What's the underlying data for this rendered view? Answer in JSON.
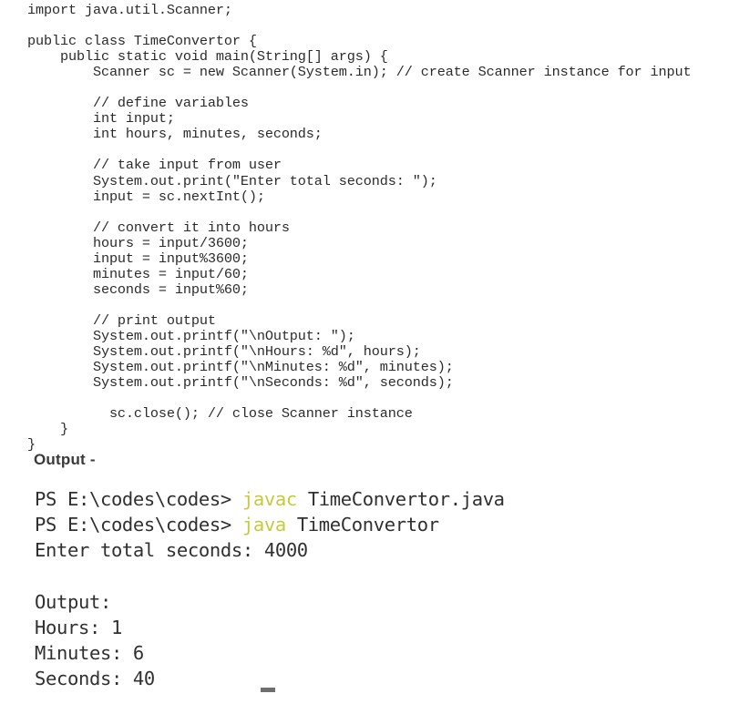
{
  "code": {
    "language": "java",
    "class_name": "TimeConvertor",
    "lines": [
      "import java.util.Scanner;",
      "",
      "public class TimeConvertor {",
      "    public static void main(String[] args) {",
      "        Scanner sc = new Scanner(System.in); // create Scanner instance for input",
      "",
      "        // define variables",
      "        int input;",
      "        int hours, minutes, seconds;",
      "",
      "        // take input from user",
      "        System.out.print(\"Enter total seconds: \");",
      "        input = sc.nextInt();",
      "",
      "        // convert it into hours",
      "        hours = input/3600;",
      "        input = input%3600;",
      "        minutes = input/60;",
      "        seconds = input%60;",
      "",
      "        // print output",
      "        System.out.printf(\"\\nOutput: \");",
      "        System.out.printf(\"\\nHours: %d\", hours);",
      "        System.out.printf(\"\\nMinutes: %d\", minutes);",
      "        System.out.printf(\"\\nSeconds: %d\", seconds);",
      "",
      "          sc.close(); // close Scanner instance",
      "    }",
      "}"
    ]
  },
  "output_section": {
    "heading": "Output -"
  },
  "terminal": {
    "keyword_color": "#c9c93f",
    "text_color": "#303030",
    "lines": [
      {
        "type": "command",
        "prompt": "PS E:\\codes\\codes> ",
        "keyword": "javac",
        "rest": " TimeConvertor.java"
      },
      {
        "type": "command",
        "prompt": "PS E:\\codes\\codes> ",
        "keyword": "java",
        "rest": " TimeConvertor"
      },
      {
        "type": "text",
        "text": "Enter total seconds: 4000"
      },
      {
        "type": "blank",
        "text": ""
      },
      {
        "type": "text",
        "text": "Output:"
      },
      {
        "type": "text",
        "text": "Hours: 1"
      },
      {
        "type": "text",
        "text": "Minutes: 6"
      },
      {
        "type": "text",
        "text": "Seconds: 40"
      }
    ],
    "input_value": "4000",
    "results": {
      "hours": "1",
      "minutes": "6",
      "seconds": "40"
    }
  }
}
